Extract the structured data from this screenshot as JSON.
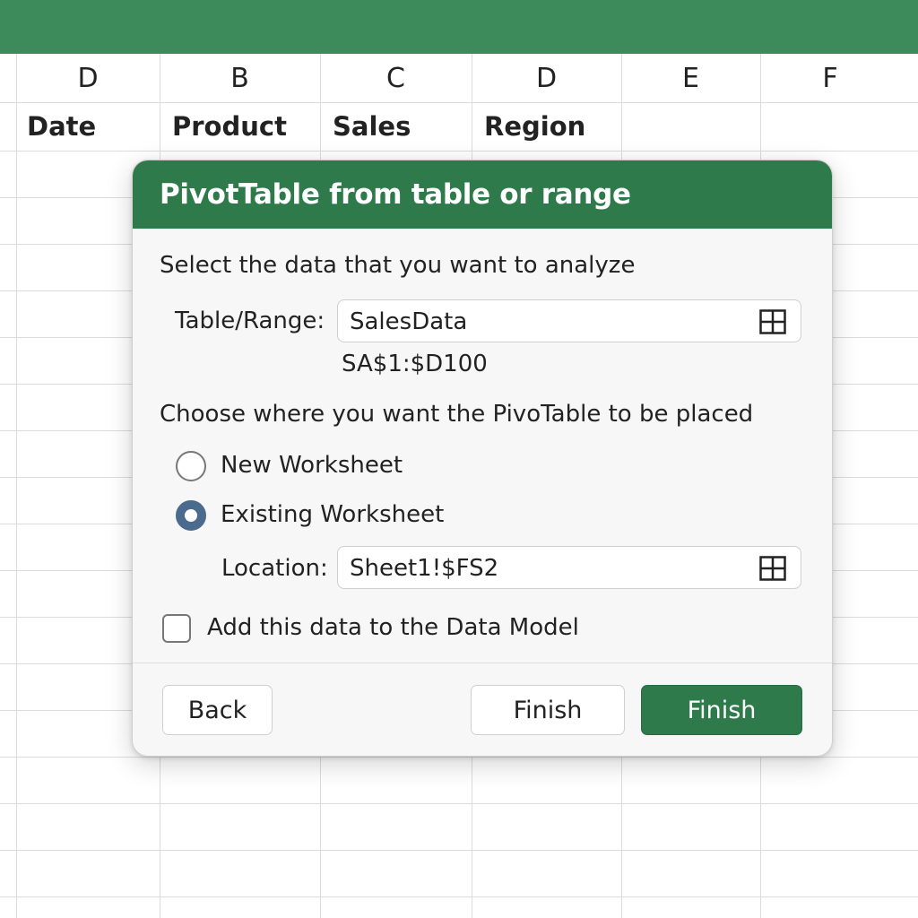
{
  "sheet": {
    "columns": [
      "D",
      "B",
      "C",
      "D",
      "E",
      "F"
    ],
    "headers": [
      "Date",
      "Product",
      "Sales",
      "Region"
    ]
  },
  "dialog": {
    "title": "PivotTable from table or range",
    "select_prompt": "Select the data that you want to analyze",
    "table_range_label": "Table/Range:",
    "table_range_value": "SalesData",
    "range_address": "SA$1:$D100",
    "place_prompt": "Choose where you want the PivoTable to be placed",
    "options": {
      "new_worksheet": "New Worksheet",
      "existing_worksheet": "Existing Worksheet",
      "selected": "existing_worksheet"
    },
    "location_label": "Location:",
    "location_value": "Sheet1!$FS2",
    "data_model_label": "Add this data to the Data Model",
    "data_model_checked": false,
    "buttons": {
      "back": "Back",
      "finish_secondary": "Finish",
      "finish_primary": "Finish"
    }
  },
  "icons": {
    "range_picker": "grid-select-icon",
    "location_picker": "grid-select-icon"
  },
  "colors": {
    "accent": "#2f7a4b",
    "topbar": "#3d8a5b",
    "radio_selected": "#4a6a8e"
  }
}
